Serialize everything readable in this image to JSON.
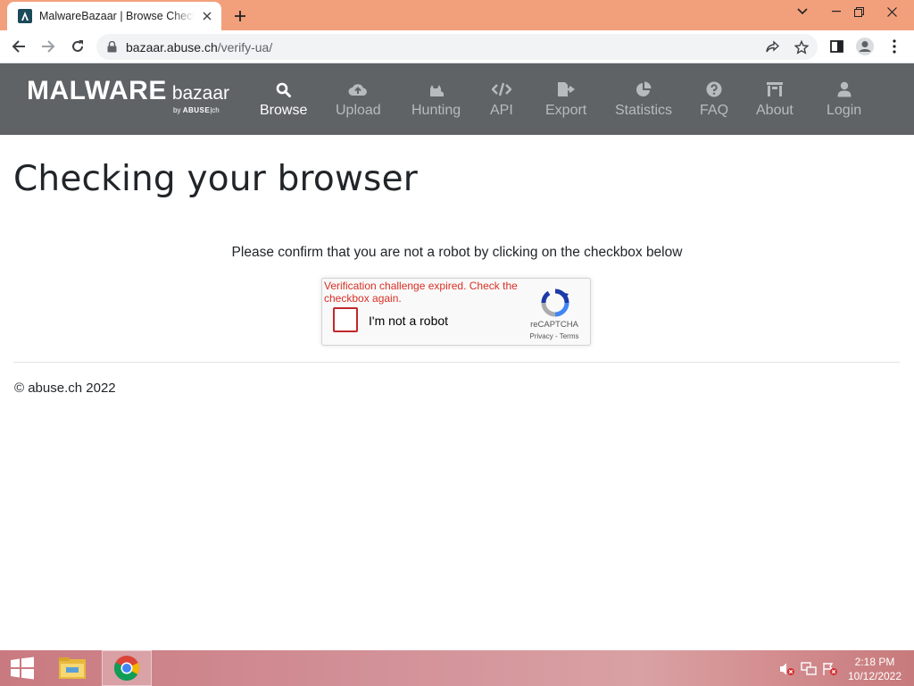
{
  "browser": {
    "tab_title": "MalwareBazaar | Browse Checking your browser",
    "url_domain": "bazaar.abuse.ch",
    "url_path": "/verify-ua/"
  },
  "site": {
    "logo_main": "MALWARE",
    "logo_sub": "bazaar",
    "logo_by": "by",
    "logo_abuse": "ABUSE",
    "logo_ch": "|ch",
    "nav": [
      {
        "label": "Browse",
        "icon": "search-icon"
      },
      {
        "label": "Upload",
        "icon": "cloud-upload-icon"
      },
      {
        "label": "Hunting",
        "icon": "cat-icon"
      },
      {
        "label": "API",
        "icon": "code-icon"
      },
      {
        "label": "Export",
        "icon": "file-export-icon"
      },
      {
        "label": "Statistics",
        "icon": "pie-chart-icon"
      },
      {
        "label": "FAQ",
        "icon": "question-circle-icon"
      },
      {
        "label": "About",
        "icon": "building-icon"
      },
      {
        "label": "Login",
        "icon": "user-icon"
      }
    ],
    "active_nav": "Browse"
  },
  "page": {
    "heading": "Checking your browser",
    "instruction": "Please confirm that you are not a robot by clicking on the checkbox below",
    "footer": "© abuse.ch 2022"
  },
  "captcha": {
    "error": "Verification challenge expired. Check the checkbox again.",
    "label": "I'm not a robot",
    "brand": "reCAPTCHA",
    "privacy": "Privacy",
    "separator": " - ",
    "terms": "Terms"
  },
  "taskbar": {
    "time": "2:18 PM",
    "date": "10/12/2022"
  },
  "colors": {
    "titlebar": "#f2a07c",
    "site_header": "#5f6366",
    "error_red": "#d93025",
    "checkbox_border": "#c1272d"
  }
}
